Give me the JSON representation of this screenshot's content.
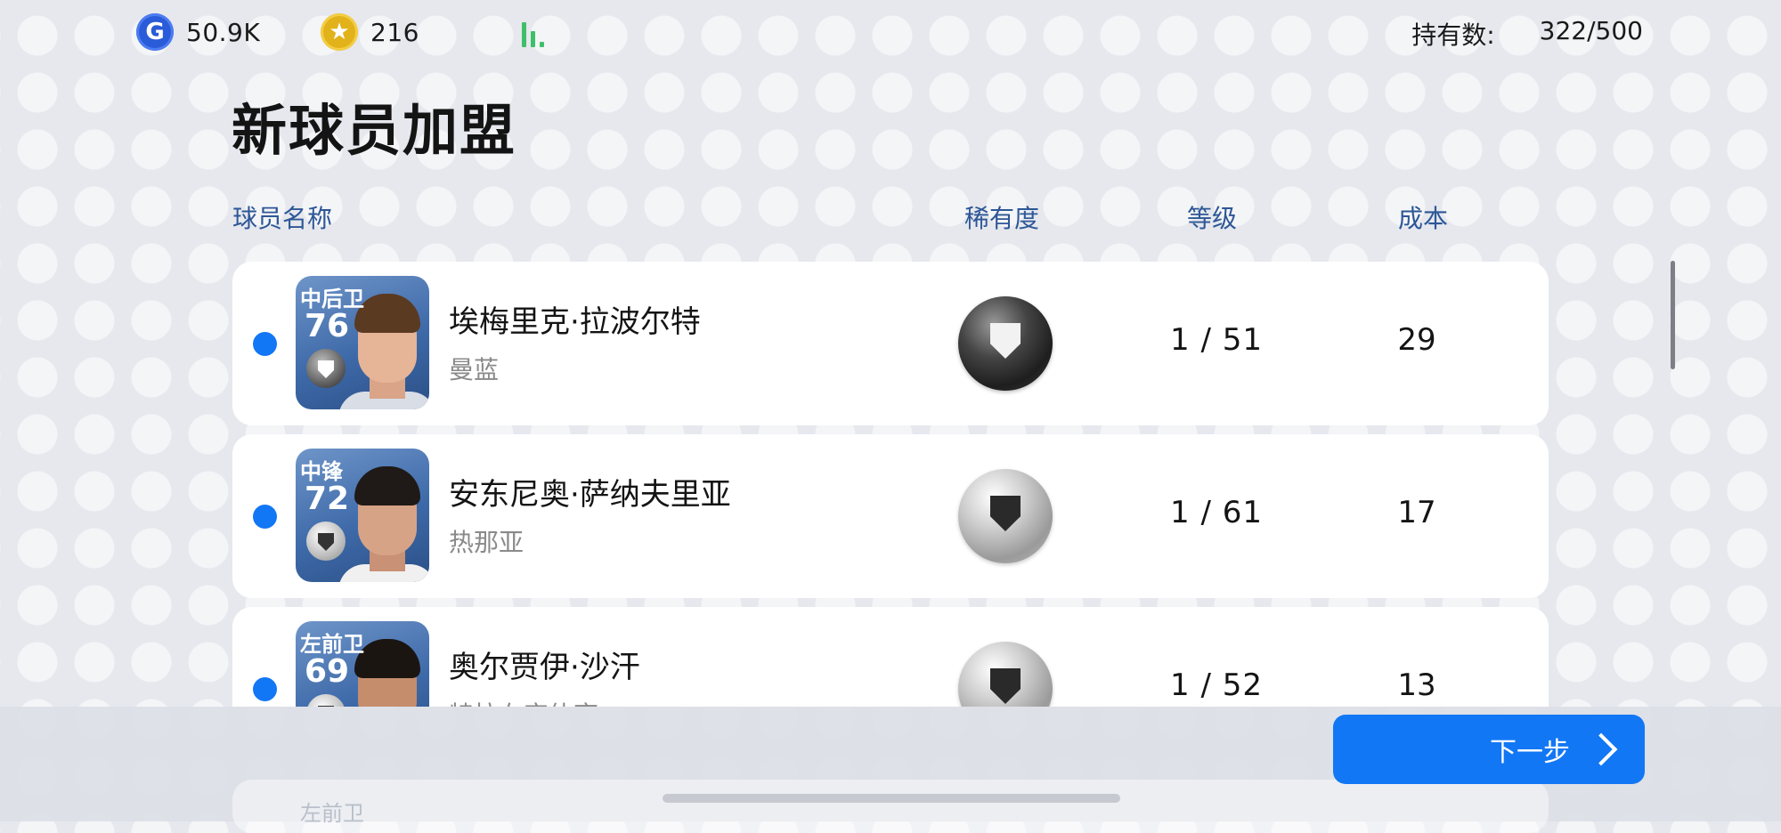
{
  "topbar": {
    "gp_icon": "G",
    "gp_value": "50.9K",
    "coin_icon": "★",
    "coin_value": "216",
    "hold_label": "持有数:",
    "hold_value": "322/500"
  },
  "page": {
    "title": "新球员加盟"
  },
  "columns": {
    "name": "球员名称",
    "rarity": "稀有度",
    "level": "等级",
    "cost": "成本"
  },
  "players": [
    {
      "position": "中后卫",
      "overall": "76",
      "name": "埃梅里克·拉波尔特",
      "club": "曼蓝",
      "rarity": "black",
      "level": "1 / 51",
      "cost": "29"
    },
    {
      "position": "中锋",
      "overall": "72",
      "name": "安东尼奥·萨纳夫里亚",
      "club": "热那亚",
      "rarity": "silver",
      "level": "1 / 61",
      "cost": "17"
    },
    {
      "position": "左前卫",
      "overall": "69",
      "name": "奥尔贾伊·沙汗",
      "club": "特拉布宗体育",
      "rarity": "silver",
      "level": "1 / 52",
      "cost": "13"
    }
  ],
  "partial_card": {
    "position": "左前卫"
  },
  "actions": {
    "next_label": "下一步"
  },
  "colors": {
    "accent": "#1277f5",
    "header_text": "#2d5796",
    "signal": "#3ec06a"
  }
}
